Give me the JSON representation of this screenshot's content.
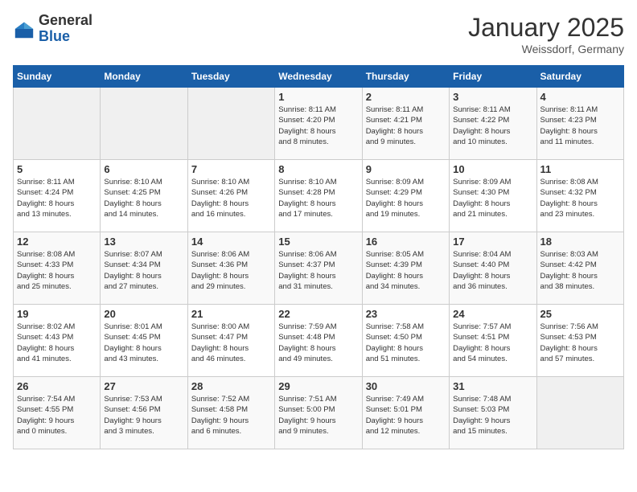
{
  "header": {
    "logo_general": "General",
    "logo_blue": "Blue",
    "title": "January 2025",
    "subtitle": "Weissdorf, Germany"
  },
  "weekdays": [
    "Sunday",
    "Monday",
    "Tuesday",
    "Wednesday",
    "Thursday",
    "Friday",
    "Saturday"
  ],
  "rows": [
    [
      {
        "num": "",
        "info": ""
      },
      {
        "num": "",
        "info": ""
      },
      {
        "num": "",
        "info": ""
      },
      {
        "num": "1",
        "info": "Sunrise: 8:11 AM\nSunset: 4:20 PM\nDaylight: 8 hours\nand 8 minutes."
      },
      {
        "num": "2",
        "info": "Sunrise: 8:11 AM\nSunset: 4:21 PM\nDaylight: 8 hours\nand 9 minutes."
      },
      {
        "num": "3",
        "info": "Sunrise: 8:11 AM\nSunset: 4:22 PM\nDaylight: 8 hours\nand 10 minutes."
      },
      {
        "num": "4",
        "info": "Sunrise: 8:11 AM\nSunset: 4:23 PM\nDaylight: 8 hours\nand 11 minutes."
      }
    ],
    [
      {
        "num": "5",
        "info": "Sunrise: 8:11 AM\nSunset: 4:24 PM\nDaylight: 8 hours\nand 13 minutes."
      },
      {
        "num": "6",
        "info": "Sunrise: 8:10 AM\nSunset: 4:25 PM\nDaylight: 8 hours\nand 14 minutes."
      },
      {
        "num": "7",
        "info": "Sunrise: 8:10 AM\nSunset: 4:26 PM\nDaylight: 8 hours\nand 16 minutes."
      },
      {
        "num": "8",
        "info": "Sunrise: 8:10 AM\nSunset: 4:28 PM\nDaylight: 8 hours\nand 17 minutes."
      },
      {
        "num": "9",
        "info": "Sunrise: 8:09 AM\nSunset: 4:29 PM\nDaylight: 8 hours\nand 19 minutes."
      },
      {
        "num": "10",
        "info": "Sunrise: 8:09 AM\nSunset: 4:30 PM\nDaylight: 8 hours\nand 21 minutes."
      },
      {
        "num": "11",
        "info": "Sunrise: 8:08 AM\nSunset: 4:32 PM\nDaylight: 8 hours\nand 23 minutes."
      }
    ],
    [
      {
        "num": "12",
        "info": "Sunrise: 8:08 AM\nSunset: 4:33 PM\nDaylight: 8 hours\nand 25 minutes."
      },
      {
        "num": "13",
        "info": "Sunrise: 8:07 AM\nSunset: 4:34 PM\nDaylight: 8 hours\nand 27 minutes."
      },
      {
        "num": "14",
        "info": "Sunrise: 8:06 AM\nSunset: 4:36 PM\nDaylight: 8 hours\nand 29 minutes."
      },
      {
        "num": "15",
        "info": "Sunrise: 8:06 AM\nSunset: 4:37 PM\nDaylight: 8 hours\nand 31 minutes."
      },
      {
        "num": "16",
        "info": "Sunrise: 8:05 AM\nSunset: 4:39 PM\nDaylight: 8 hours\nand 34 minutes."
      },
      {
        "num": "17",
        "info": "Sunrise: 8:04 AM\nSunset: 4:40 PM\nDaylight: 8 hours\nand 36 minutes."
      },
      {
        "num": "18",
        "info": "Sunrise: 8:03 AM\nSunset: 4:42 PM\nDaylight: 8 hours\nand 38 minutes."
      }
    ],
    [
      {
        "num": "19",
        "info": "Sunrise: 8:02 AM\nSunset: 4:43 PM\nDaylight: 8 hours\nand 41 minutes."
      },
      {
        "num": "20",
        "info": "Sunrise: 8:01 AM\nSunset: 4:45 PM\nDaylight: 8 hours\nand 43 minutes."
      },
      {
        "num": "21",
        "info": "Sunrise: 8:00 AM\nSunset: 4:47 PM\nDaylight: 8 hours\nand 46 minutes."
      },
      {
        "num": "22",
        "info": "Sunrise: 7:59 AM\nSunset: 4:48 PM\nDaylight: 8 hours\nand 49 minutes."
      },
      {
        "num": "23",
        "info": "Sunrise: 7:58 AM\nSunset: 4:50 PM\nDaylight: 8 hours\nand 51 minutes."
      },
      {
        "num": "24",
        "info": "Sunrise: 7:57 AM\nSunset: 4:51 PM\nDaylight: 8 hours\nand 54 minutes."
      },
      {
        "num": "25",
        "info": "Sunrise: 7:56 AM\nSunset: 4:53 PM\nDaylight: 8 hours\nand 57 minutes."
      }
    ],
    [
      {
        "num": "26",
        "info": "Sunrise: 7:54 AM\nSunset: 4:55 PM\nDaylight: 9 hours\nand 0 minutes."
      },
      {
        "num": "27",
        "info": "Sunrise: 7:53 AM\nSunset: 4:56 PM\nDaylight: 9 hours\nand 3 minutes."
      },
      {
        "num": "28",
        "info": "Sunrise: 7:52 AM\nSunset: 4:58 PM\nDaylight: 9 hours\nand 6 minutes."
      },
      {
        "num": "29",
        "info": "Sunrise: 7:51 AM\nSunset: 5:00 PM\nDaylight: 9 hours\nand 9 minutes."
      },
      {
        "num": "30",
        "info": "Sunrise: 7:49 AM\nSunset: 5:01 PM\nDaylight: 9 hours\nand 12 minutes."
      },
      {
        "num": "31",
        "info": "Sunrise: 7:48 AM\nSunset: 5:03 PM\nDaylight: 9 hours\nand 15 minutes."
      },
      {
        "num": "",
        "info": ""
      }
    ]
  ]
}
